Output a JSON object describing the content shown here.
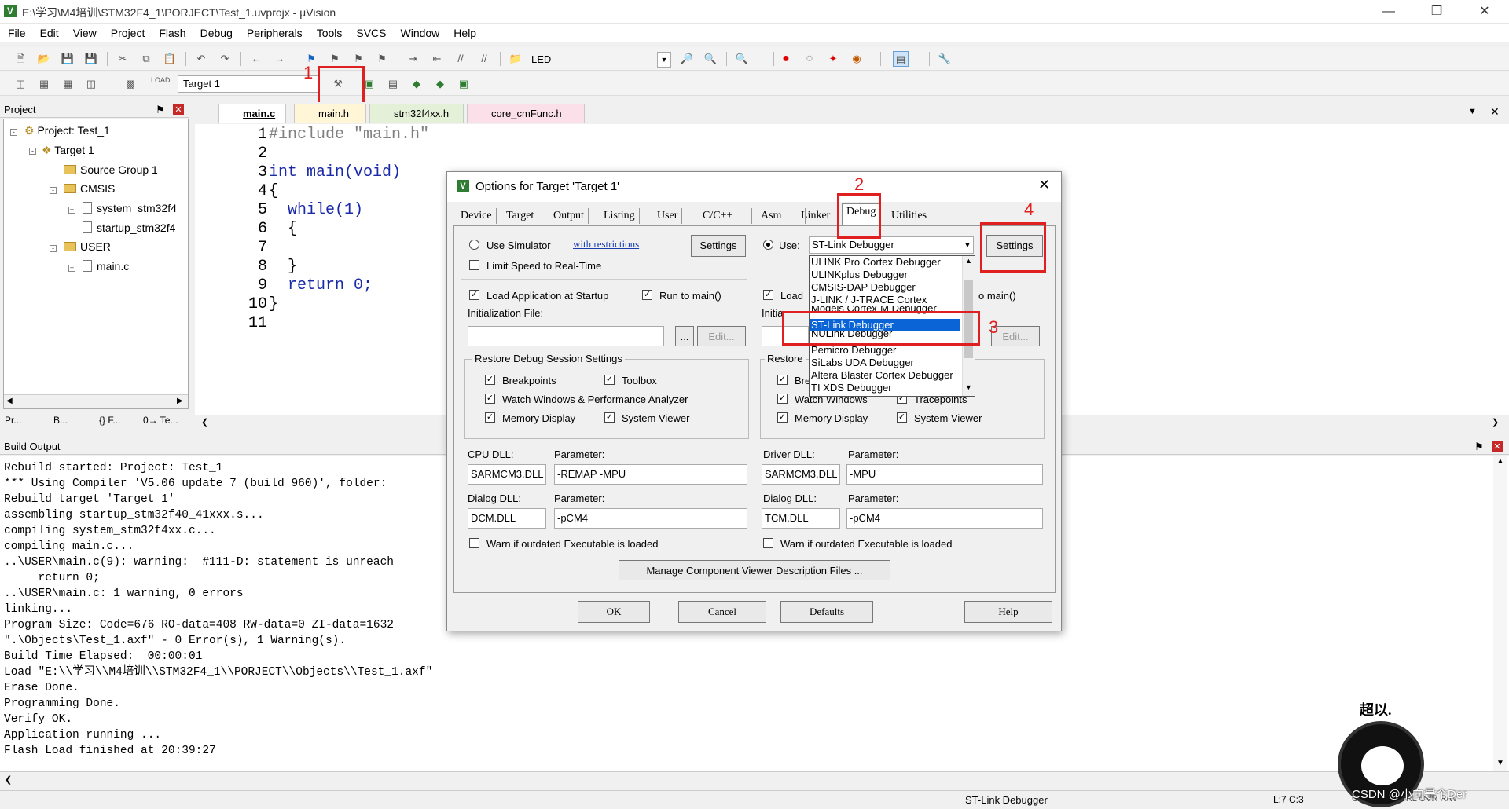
{
  "window": {
    "title": "E:\\学习\\M4培训\\STM32F4_1\\PORJECT\\Test_1.uvprojx - µVision"
  },
  "menu": [
    "File",
    "Edit",
    "View",
    "Project",
    "Flash",
    "Debug",
    "Peripherals",
    "Tools",
    "SVCS",
    "Window",
    "Help"
  ],
  "toolbar": {
    "find_text": "LED",
    "target": "Target 1"
  },
  "annotations": [
    "1",
    "2",
    "3",
    "4"
  ],
  "project": {
    "header": "Project",
    "root": "Project: Test_1",
    "target": "Target 1",
    "group1": "Source Group 1",
    "cmsis": "CMSIS",
    "file1": "system_stm32f4",
    "file2": "startup_stm32f4",
    "user": "USER",
    "file3": "main.c",
    "bottom_tabs": [
      "Pr...",
      "B...",
      "{} F...",
      "0→ Te..."
    ]
  },
  "editor": {
    "tabs": [
      "main.c",
      "main.h",
      "stm32f4xx.h",
      "core_cmFunc.h"
    ],
    "line_numbers": [
      "1",
      "2",
      "3",
      "4",
      "5",
      "6",
      "7",
      "8",
      "9",
      "10",
      "11"
    ],
    "lines": [
      "#include \"main.h\"",
      "",
      "int main(void)",
      "{",
      "  while(1)",
      "  {",
      "",
      "  }",
      "  return 0;",
      "}",
      ""
    ]
  },
  "build": {
    "header": "Build Output",
    "lines": [
      "Rebuild started: Project: Test_1",
      "*** Using Compiler 'V5.06 update 7 (build 960)', folder:",
      "Rebuild target 'Target 1'",
      "assembling startup_stm32f40_41xxx.s...",
      "compiling system_stm32f4xx.c...",
      "compiling main.c...",
      "..\\USER\\main.c(9): warning:  #111-D: statement is unreach",
      "     return 0;",
      "..\\USER\\main.c: 1 warning, 0 errors",
      "linking...",
      "Program Size: Code=676 RO-data=408 RW-data=0 ZI-data=1632",
      "\".\\Objects\\Test_1.axf\" - 0 Error(s), 1 Warning(s).",
      "Build Time Elapsed:  00:00:01",
      "Load \"E:\\\\学习\\\\M4培训\\\\STM32F4_1\\\\PORJECT\\\\Objects\\\\Test_1.axf\"",
      "Erase Done.",
      "Programming Done.",
      "Verify OK.",
      "Application running ...",
      "Flash Load finished at 20:39:27"
    ]
  },
  "status": {
    "debugger": "ST-Link Debugger",
    "pos": "L:7 C:3",
    "caps": "CAP  NUM  SCRL  OVR  R/W"
  },
  "watermark": {
    "sig": "超以.",
    "credit": "CSDN @小向是个Der"
  },
  "dialog": {
    "title": "Options for Target 'Target 1'",
    "tabs": [
      "Device",
      "Target",
      "Output",
      "Listing",
      "User",
      "C/C++",
      "Asm",
      "Linker",
      "Debug",
      "Utilities"
    ],
    "left": {
      "use_simulator": "Use Simulator",
      "restrictions": "with restrictions",
      "settings": "Settings",
      "limit_speed": "Limit Speed to Real-Time",
      "load_app": "Load Application at Startup",
      "run_main": "Run to main()",
      "init_file": "Initialization File:",
      "browse": "...",
      "edit": "Edit...",
      "restore": "Restore Debug Session Settings",
      "breakpoints": "Breakpoints",
      "toolbox": "Toolbox",
      "watch": "Watch Windows & Performance Analyzer",
      "memory": "Memory Display",
      "sysviewer": "System Viewer",
      "cpu_dll_label": "CPU DLL:",
      "param_label": "Parameter:",
      "cpu_dll": "SARMCM3.DLL",
      "cpu_param": "-REMAP -MPU",
      "dialog_dll_label": "Dialog DLL:",
      "dialog_dll": "DCM.DLL",
      "dialog_param": "-pCM4",
      "warn": "Warn if outdated Executable is loaded"
    },
    "right": {
      "use": "Use:",
      "selected": "ST-Link Debugger",
      "settings": "Settings",
      "load": "Load",
      "run_main": "o main()",
      "init_short": "Initia",
      "edit": "Edit...",
      "restore": "Restore",
      "bre": "Bre",
      "watch": "Watch Windows",
      "tracepoints": "Tracepoints",
      "memory": "Memory Display",
      "sysviewer": "System Viewer",
      "driver_dll_label": "Driver DLL:",
      "param_label": "Parameter:",
      "driver_dll": "SARMCM3.DLL",
      "driver_param": "-MPU",
      "dialog_dll_label": "Dialog DLL:",
      "dialog_dll": "TCM.DLL",
      "dialog_param": "-pCM4",
      "warn": "Warn if outdated Executable is loaded"
    },
    "dropdown": [
      "ULINK Pro Cortex Debugger",
      "ULINKplus Debugger",
      "CMSIS-DAP Debugger",
      "J-LINK / J-TRACE Cortex",
      "Models Cortex-M Debugger",
      "ST-Link Debugger",
      "NULink Debugger",
      "Pemicro Debugger",
      "SiLabs UDA Debugger",
      "Altera Blaster Cortex Debugger",
      "TI XDS Debugger"
    ],
    "manage": "Manage Component Viewer Description Files ...",
    "buttons": {
      "ok": "OK",
      "cancel": "Cancel",
      "defaults": "Defaults",
      "help": "Help"
    }
  }
}
